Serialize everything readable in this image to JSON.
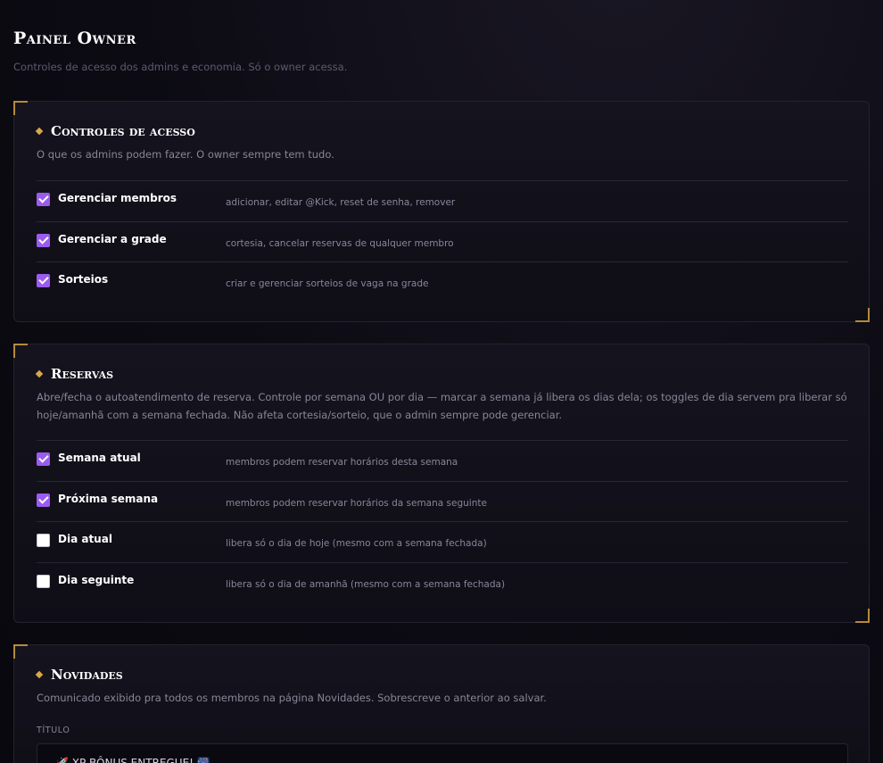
{
  "page": {
    "title": "Painel Owner",
    "subtitle": "Controles de acesso dos admins e economia. Só o owner acessa."
  },
  "access": {
    "title": "Controles de acesso",
    "description": "O que os admins podem fazer. O owner sempre tem tudo.",
    "items": [
      {
        "label": "Gerenciar membros",
        "hint": "adicionar, editar @Kick, reset de senha, remover",
        "checked": true
      },
      {
        "label": "Gerenciar a grade",
        "hint": "cortesia, cancelar reservas de qualquer membro",
        "checked": true
      },
      {
        "label": "Sorteios",
        "hint": "criar e gerenciar sorteios de vaga na grade",
        "checked": true
      }
    ]
  },
  "reservas": {
    "title": "Reservas",
    "description": "Abre/fecha o autoatendimento de reserva. Controle por semana OU por dia — marcar a semana já libera os dias dela; os toggles de dia servem pra liberar só hoje/amanhã com a semana fechada. Não afeta cortesia/sorteio, que o admin sempre pode gerenciar.",
    "items": [
      {
        "label": "Semana atual",
        "hint": "membros podem reservar horários desta semana",
        "checked": true
      },
      {
        "label": "Próxima semana",
        "hint": "membros podem reservar horários da semana seguinte",
        "checked": true
      },
      {
        "label": "Dia atual",
        "hint": "libera só o dia de hoje (mesmo com a semana fechada)",
        "checked": false
      },
      {
        "label": "Dia seguinte",
        "hint": "libera só o dia de amanhã (mesmo com a semana fechada)",
        "checked": false
      }
    ]
  },
  "novidades": {
    "title": "Novidades",
    "description": "Comunicado exibido pra todos os membros na página Novidades. Sobrescreve o anterior ao salvar.",
    "field_label": "TÍTULO",
    "field_value": "🚀 XP BÔNUS ENTREGUE! 🎆"
  },
  "colors": {
    "accent": "#9c5bf0",
    "gold": "#b58a3a"
  }
}
